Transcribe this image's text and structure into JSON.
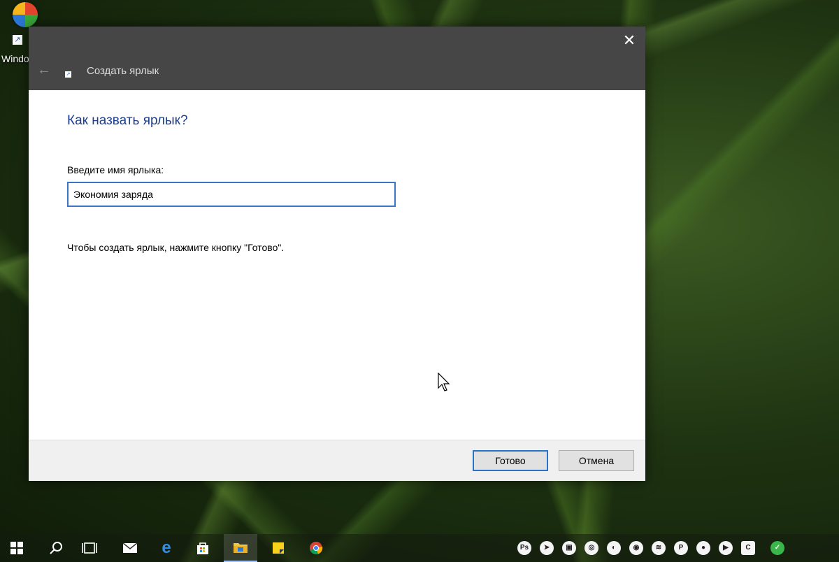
{
  "desktop": {
    "icon_label": "Windows Media Player"
  },
  "dialog": {
    "wizard_title": "Создать ярлык",
    "close_glyph": "✕",
    "back_glyph": "←",
    "heading": "Как назвать ярлык?",
    "field_label": "Введите имя ярлыка:",
    "name_value": "Экономия заряда",
    "hint": "Чтобы создать ярлык, нажмите кнопку \"Готово\".",
    "finish_label": "Готово",
    "cancel_label": "Отмена"
  },
  "taskbar": {
    "items": [
      {
        "name": "start-button",
        "icon": "windows-logo-icon"
      },
      {
        "name": "search-button",
        "icon": "search-icon"
      },
      {
        "name": "task-view-button",
        "icon": "task-view-icon"
      },
      {
        "name": "mail-app",
        "icon": "mail-icon"
      },
      {
        "name": "edge-app",
        "icon": "edge-icon"
      },
      {
        "name": "store-app",
        "icon": "store-icon"
      },
      {
        "name": "file-explorer-app",
        "icon": "folder-icon"
      },
      {
        "name": "sticky-notes-app",
        "icon": "sticky-notes-icon"
      },
      {
        "name": "chrome-app",
        "icon": "chrome-icon"
      }
    ],
    "tray_icons": [
      "Ps",
      "telegram",
      "photos",
      "chrome",
      "app",
      "app",
      "app",
      "P",
      "app",
      "app",
      "C",
      "app"
    ]
  },
  "colors": {
    "accent": "#2b73c6",
    "heading": "#1e3f8f",
    "titlebar": "#464646"
  }
}
